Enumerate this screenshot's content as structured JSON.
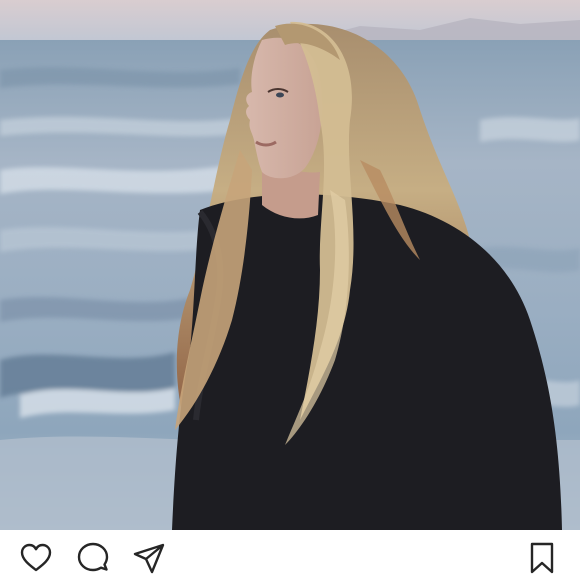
{
  "post": {
    "photo": {
      "subject": "woman-on-beach-photo"
    },
    "actions": {
      "like_icon": "heart-outline-icon",
      "comment_icon": "speech-bubble-outline-icon",
      "share_icon": "paper-plane-outline-icon",
      "save_icon": "bookmark-outline-icon"
    },
    "colors": {
      "icon_stroke": "#262626",
      "bar_background": "#ffffff"
    }
  }
}
